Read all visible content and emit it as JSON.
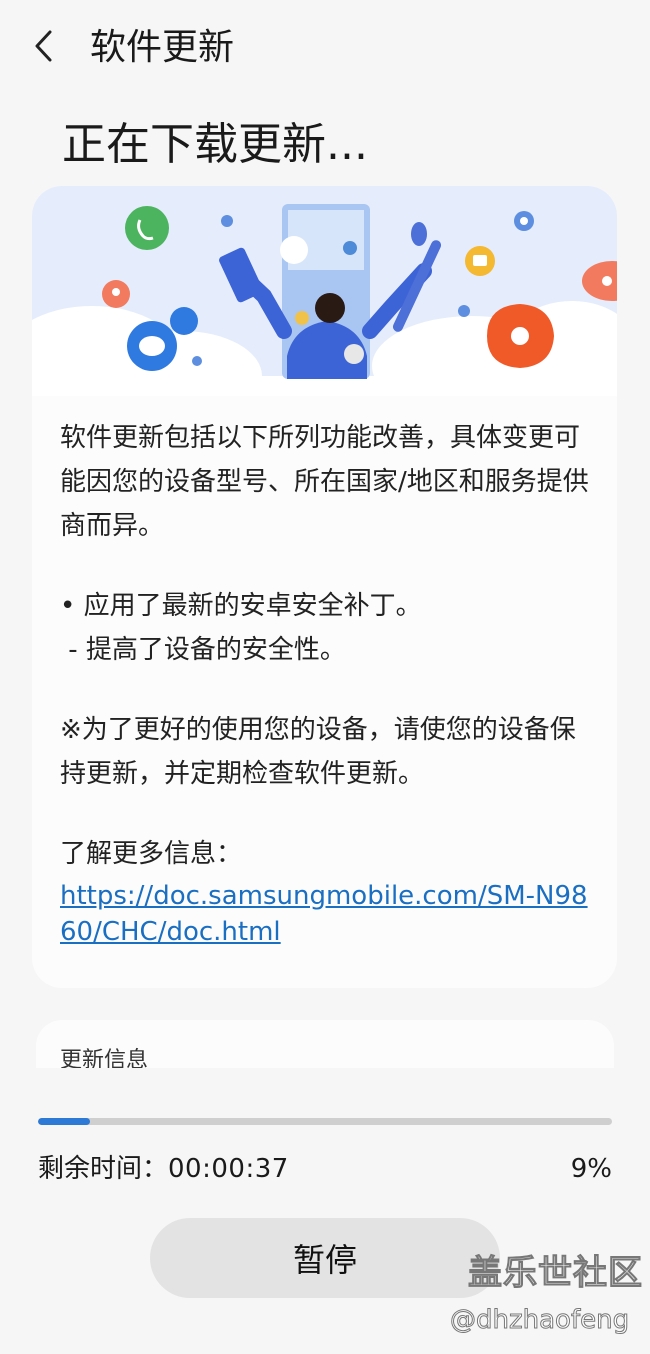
{
  "appbar": {
    "title": "软件更新",
    "back_icon": "chevron-left-icon"
  },
  "headline": "正在下载更新...",
  "card": {
    "paragraph": "软件更新包括以下所列功能改善，具体变更可能因您的设备型号、所在国家/地区和服务提供商而异。",
    "bullet": "• 应用了最新的安卓安全补丁。",
    "sub_bullet": " - 提高了设备的安全性。",
    "note": "※为了更好的使用您的设备，请使您的设备保持更新，并定期检查软件更新。",
    "more_info_label": "了解更多信息：",
    "link": "https://doc.samsungmobile.com/SM-N9860/CHC/doc.html"
  },
  "update_info_label": "更新信息",
  "progress": {
    "percent": 9,
    "percent_label": "9%",
    "remaining_label": "剩余时间：",
    "remaining_value": "00:00:37",
    "accent": "#2d7ad6"
  },
  "pause_label": "暂停",
  "watermark": {
    "title": "盖乐世社区",
    "user": "@dhzhaofeng"
  }
}
